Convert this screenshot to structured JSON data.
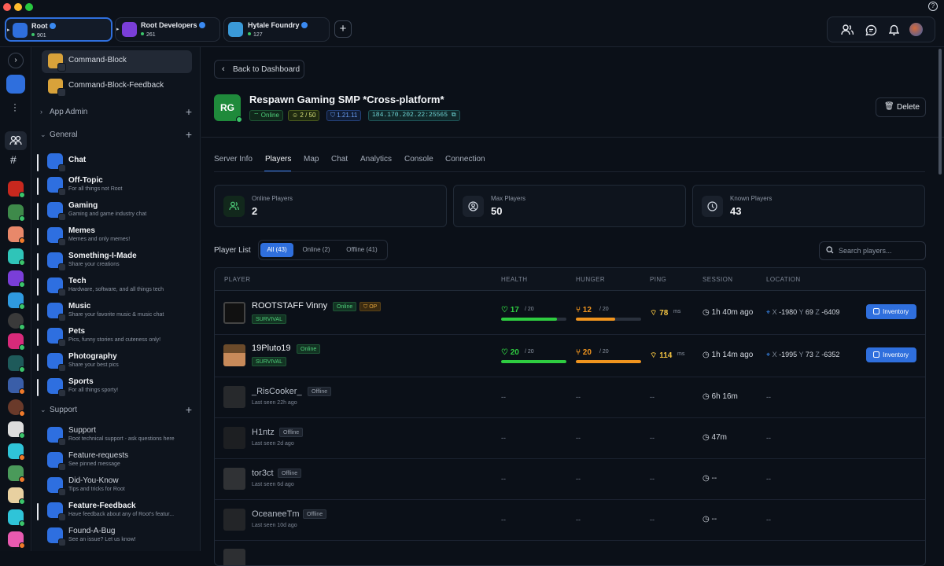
{
  "tabs": [
    {
      "name": "Root",
      "count": "901",
      "color": "#2f6fdd"
    },
    {
      "name": "Root Developers",
      "count": "261",
      "color": "#7a3ed8"
    },
    {
      "name": "Hytale Foundry",
      "count": "127",
      "color": "#3a9ad8"
    }
  ],
  "top_icons": [
    "users-icon",
    "chat-bubble-icon",
    "bell-icon",
    "avatar"
  ],
  "rail": {
    "expand_icon": "chevron-right-icon",
    "more_icon": "more-vertical-icon"
  },
  "sidebar": {
    "pinned": [
      {
        "label": "Command-Block"
      },
      {
        "label": "Command-Block-Feedback"
      }
    ],
    "app_admin": "App Admin",
    "general_label": "General",
    "general_channels": [
      {
        "name": "Chat",
        "desc": ""
      },
      {
        "name": "Off-Topic",
        "desc": "For all things not Root"
      },
      {
        "name": "Gaming",
        "desc": "Gaming and game industry chat"
      },
      {
        "name": "Memes",
        "desc": "Memes and only memes!"
      },
      {
        "name": "Something-I-Made",
        "desc": "Share your creations"
      },
      {
        "name": "Tech",
        "desc": "Hardware, software, and all things tech"
      },
      {
        "name": "Music",
        "desc": "Share your favorite music & music chat"
      },
      {
        "name": "Pets",
        "desc": "Pics, funny stories and cuteness only!"
      },
      {
        "name": "Photography",
        "desc": "Share your best pics"
      },
      {
        "name": "Sports",
        "desc": "For all things sporty!"
      }
    ],
    "support_label": "Support",
    "support_channels": [
      {
        "name": "Support",
        "desc": "Root technical support - ask questions here"
      },
      {
        "name": "Feature-requests",
        "desc": "See pinned message"
      },
      {
        "name": "Did-You-Know",
        "desc": "Tips and tricks for Root"
      },
      {
        "name": "Feature-Feedback",
        "desc": "Have feedback about any of Root's featur..."
      },
      {
        "name": "Found-A-Bug",
        "desc": "See an issue? Let us know!"
      }
    ]
  },
  "main": {
    "back_label": "Back to Dashboard",
    "server": {
      "logo_text": "RG",
      "title": "Respawn Gaming SMP *Cross-platform*",
      "status": "Online",
      "players": "2 / 50",
      "version": "1.21.11",
      "address": "184.170.202.22:25565"
    },
    "delete_label": "Delete",
    "tabs": [
      "Server Info",
      "Players",
      "Map",
      "Chat",
      "Analytics",
      "Console",
      "Connection"
    ],
    "active_tab": "Players",
    "stats": [
      {
        "label": "Online Players",
        "value": "2",
        "icon": "users-icon"
      },
      {
        "label": "Max Players",
        "value": "50",
        "icon": "user-circle-icon"
      },
      {
        "label": "Known Players",
        "value": "43",
        "icon": "clock-icon"
      }
    ],
    "list_label": "Player List",
    "filters": [
      "All (43)",
      "Online (2)",
      "Offline (41)"
    ],
    "search_placeholder": "Search players...",
    "columns": [
      "PLAYER",
      "HEALTH",
      "HUNGER",
      "PING",
      "SESSION",
      "LOCATION"
    ],
    "online_players": [
      {
        "name": "ROOTSTAFF Vinny",
        "status": "Online",
        "op": "OP",
        "mode": "SURVIVAL",
        "health": "17",
        "health_max": "/ 20",
        "health_frac": 0.85,
        "hunger": "12",
        "hunger_max": "/ 20",
        "hunger_frac": 0.6,
        "ping": "78",
        "ping_unit": "ms",
        "session": "1h 40m ago",
        "x_label": "X",
        "x": "-1980",
        "y_label": "Y",
        "y": "69",
        "z_label": "Z",
        "z": "-6409",
        "action": "Inventory"
      },
      {
        "name": "19Pluto19",
        "status": "Online",
        "op": "",
        "mode": "SURVIVAL",
        "health": "20",
        "health_max": "/ 20",
        "health_frac": 1.0,
        "hunger": "20",
        "hunger_max": "/ 20",
        "hunger_frac": 1.0,
        "ping": "114",
        "ping_unit": "ms",
        "session": "1h 14m ago",
        "x_label": "X",
        "x": "-1995",
        "y_label": "Y",
        "y": "73",
        "z_label": "Z",
        "z": "-6352",
        "action": "Inventory"
      }
    ],
    "offline_players": [
      {
        "name": "_RisCooker_",
        "status": "Offline",
        "last_seen": "Last seen 22h ago",
        "session": "6h 16m",
        "health": "--",
        "hunger": "--",
        "ping": "--",
        "location": "--"
      },
      {
        "name": "H1ntz",
        "status": "Offline",
        "last_seen": "Last seen 2d ago",
        "session": "47m",
        "health": "--",
        "hunger": "--",
        "ping": "--",
        "location": "--"
      },
      {
        "name": "tor3ct",
        "status": "Offline",
        "last_seen": "Last seen 6d ago",
        "session": "--",
        "health": "--",
        "hunger": "--",
        "ping": "--",
        "location": "--"
      },
      {
        "name": "OceaneeTm",
        "status": "Offline",
        "last_seen": "Last seen 10d ago",
        "session": "--",
        "health": "--",
        "hunger": "--",
        "ping": "--",
        "location": "--"
      }
    ]
  },
  "colors": {
    "accent": "#2f6fdd",
    "online": "#3bc56a",
    "health": "#2ecc40",
    "hunger": "#f0941e",
    "ping": "#f5c542"
  }
}
